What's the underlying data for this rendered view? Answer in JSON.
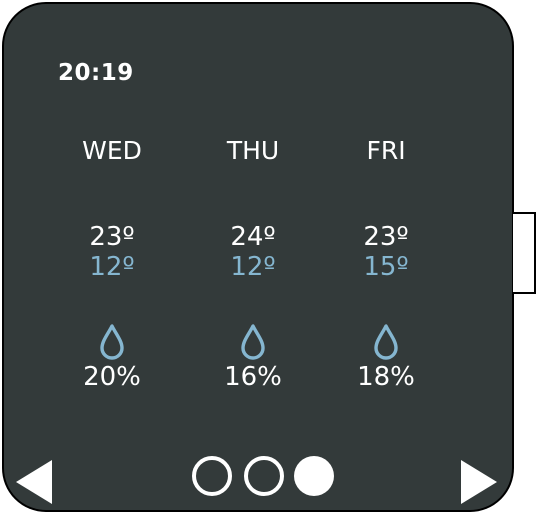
{
  "status": {
    "time": "20:19"
  },
  "forecast": [
    {
      "day": "WED",
      "high": "23º",
      "low": "12º",
      "precip": "20%"
    },
    {
      "day": "THU",
      "high": "24º",
      "low": "12º",
      "precip": "16%"
    },
    {
      "day": "FRI",
      "high": "23º",
      "low": "15º",
      "precip": "18%"
    }
  ],
  "pager": {
    "pages": 3,
    "current_page": 3
  },
  "colors": {
    "background": "#333a3a",
    "text": "#ffffff",
    "low_temp": "#85b6d0",
    "drop_icon": "#85b6d0"
  },
  "icons": {
    "precip": "water-drop-icon",
    "prev": "triangle-left-icon",
    "next": "triangle-right-icon"
  }
}
